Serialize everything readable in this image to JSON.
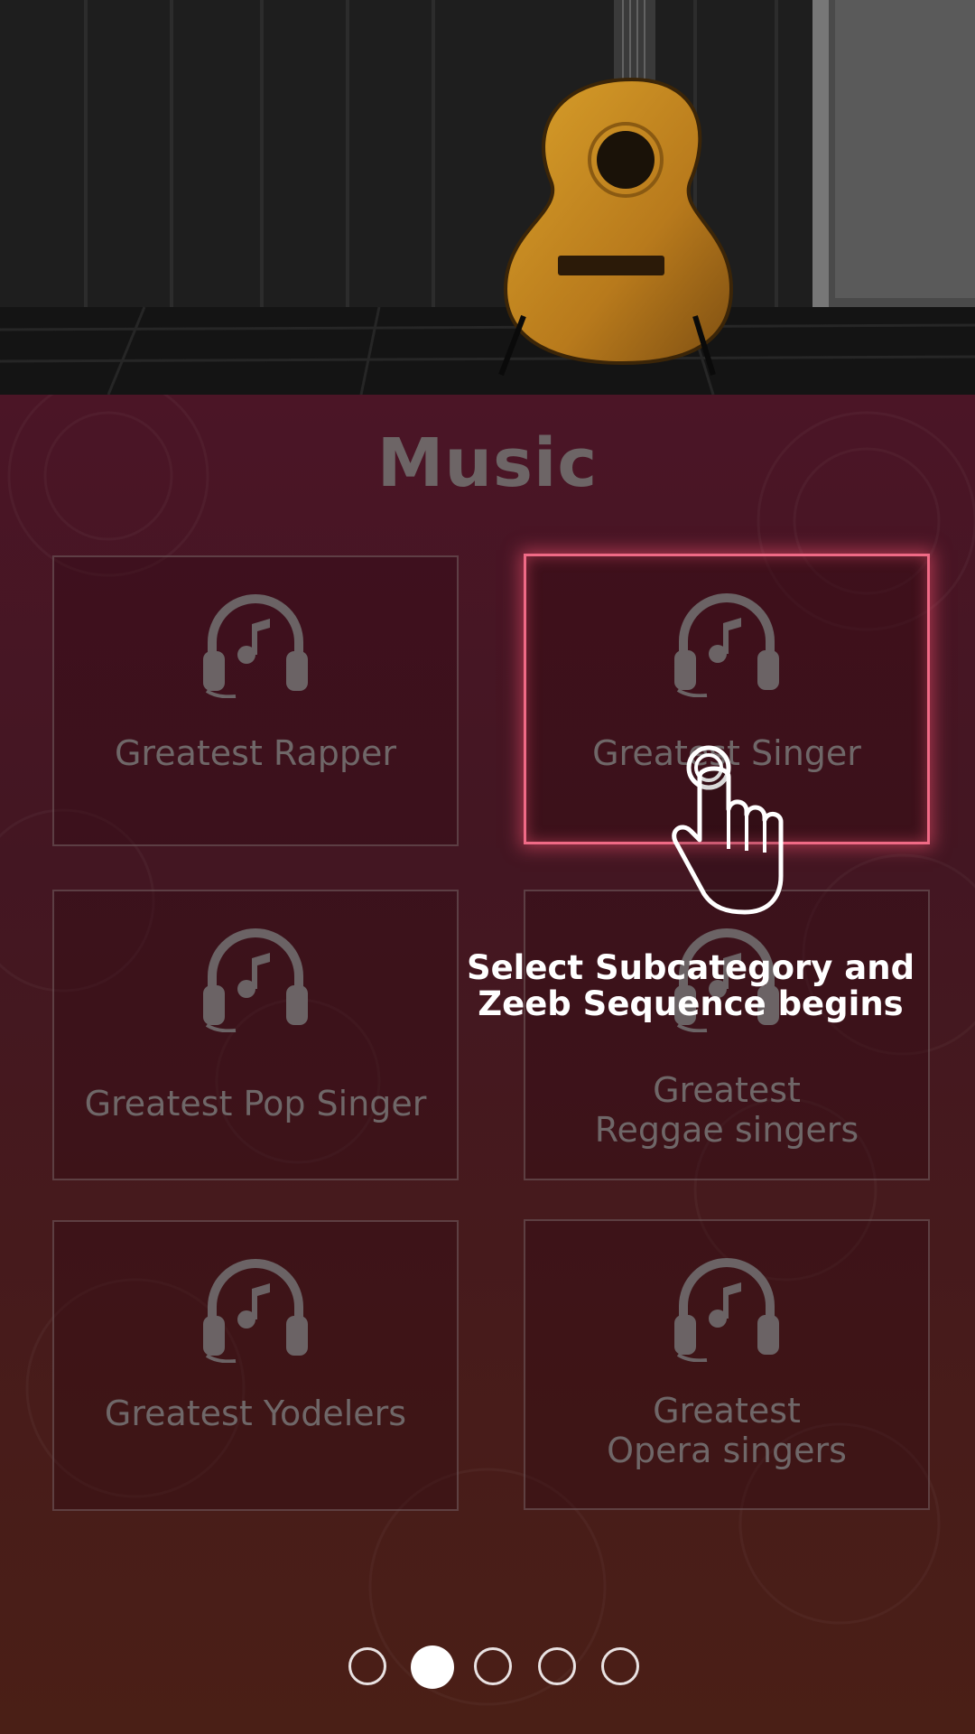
{
  "page": {
    "title": "Music"
  },
  "hero": {
    "image": "acoustic-guitar-photo"
  },
  "tiles": [
    {
      "label": "Greatest Rapper",
      "icon": "headphones-music-icon",
      "selected": false
    },
    {
      "label": "Greatest Singer",
      "icon": "headphones-music-icon",
      "selected": true
    },
    {
      "label": "Greatest Pop Singer",
      "icon": "headphones-music-icon",
      "selected": false
    },
    {
      "label": "Greatest\nReggae singers",
      "icon": "headphones-music-icon",
      "selected": false
    },
    {
      "label": "Greatest Yodelers",
      "icon": "headphones-music-icon",
      "selected": false
    },
    {
      "label": "Greatest\nOpera singers",
      "icon": "headphones-music-icon",
      "selected": false
    }
  ],
  "overlay": {
    "instruction": "Select Subcategory and\nZeeb Sequence begins",
    "icon": "hand-pointer-icon"
  },
  "pagination": {
    "total": 5,
    "active_index": 1
  },
  "colors": {
    "accent": "#f06a86",
    "panel_top": "#4b1526",
    "panel_bottom": "#4a1f16"
  }
}
